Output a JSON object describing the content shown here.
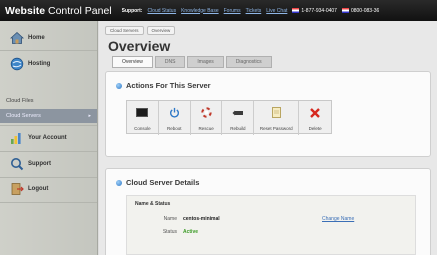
{
  "app": {
    "title_bold": "Website",
    "title_rest": " Control Panel"
  },
  "support": {
    "label": "Support:",
    "links": [
      "Cloud Status",
      "Knowledge Base",
      "Forums",
      "Tickets",
      "Live Chat"
    ],
    "phones": [
      "1-877-934-0407",
      "0800-083-36"
    ]
  },
  "sidebar": {
    "items": [
      {
        "label": "Home",
        "icon": "home-icon"
      },
      {
        "label": "Hosting",
        "icon": "hosting-icon"
      },
      {
        "label": "Your Account",
        "icon": "account-icon"
      },
      {
        "label": "Support",
        "icon": "support-icon"
      },
      {
        "label": "Logout",
        "icon": "logout-icon"
      }
    ],
    "subitems": [
      {
        "label": "Cloud Files"
      },
      {
        "label": "Cloud Servers",
        "arrow": "▸"
      }
    ]
  },
  "breadcrumb": [
    "Cloud Servers",
    "Overview"
  ],
  "page_title": "Overview",
  "tabs": [
    "Overview",
    "DNS",
    "Images",
    "Diagnostics"
  ],
  "actions": {
    "heading": "Actions For This Server",
    "buttons": [
      "Console",
      "Reboot",
      "Rescue",
      "Rebuild",
      "Reset Password",
      "Delete"
    ]
  },
  "details": {
    "heading": "Cloud Server Details",
    "section": "Name & Status",
    "name_label": "Name",
    "name_value": "centos-minimal",
    "change_link": "Change Name",
    "status_label": "Status",
    "status_value": "Active"
  },
  "colors": {
    "accent": "#2e78c7",
    "delete": "#d6281f",
    "status_active": "#3b9b25"
  }
}
